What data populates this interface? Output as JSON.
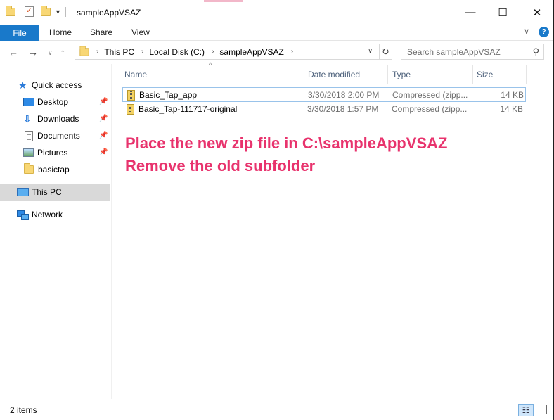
{
  "window": {
    "title": "sampleAppVSAZ",
    "controls": {
      "minimize": "—",
      "maximize": "☐",
      "close": "✕"
    }
  },
  "ribbon": {
    "tabs": [
      "File",
      "Home",
      "Share",
      "View"
    ],
    "expand_icon": "chevron-down-icon",
    "help_icon": "?"
  },
  "address": {
    "crumbs": [
      "This PC",
      "Local Disk (C:)",
      "sampleAppVSAZ"
    ],
    "search_placeholder": "Search sampleAppVSAZ"
  },
  "navigation": {
    "quick_access": "Quick access",
    "pinned": [
      "Desktop",
      "Downloads",
      "Documents",
      "Pictures"
    ],
    "recent": "basictap",
    "this_pc": "This PC",
    "network": "Network"
  },
  "columns": [
    "Name",
    "Date modified",
    "Type",
    "Size"
  ],
  "files": [
    {
      "name": "Basic_Tap_app",
      "date": "3/30/2018 2:00 PM",
      "type": "Compressed (zipp...",
      "size": "14 KB"
    },
    {
      "name": "Basic_Tap-111717-original",
      "date": "3/30/2018 1:57 PM",
      "type": "Compressed (zipp...",
      "size": "14 KB"
    }
  ],
  "annotation": {
    "line1": "Place the new zip file in C:\\sampleAppVSAZ",
    "line2": "Remove the old subfolder",
    "color": "#e8336d"
  },
  "status": {
    "item_count": "2 items"
  },
  "colors": {
    "accent": "#1979ca",
    "selection": "#d9d9d9"
  }
}
